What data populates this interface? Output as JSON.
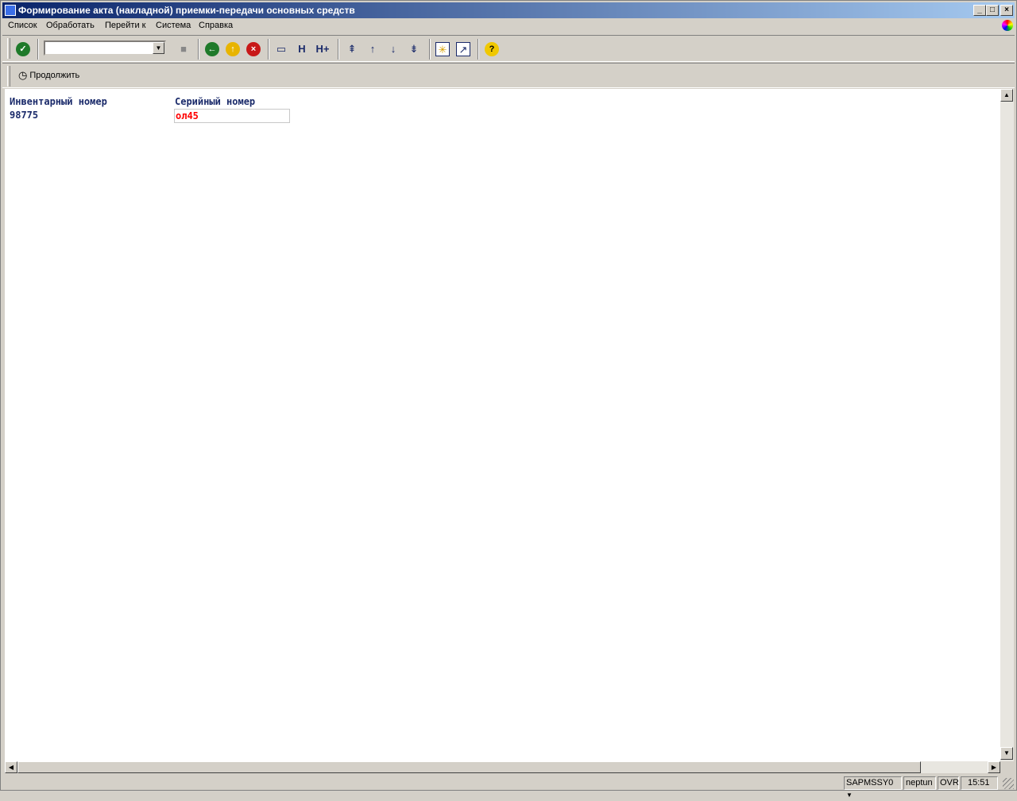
{
  "window": {
    "title": "Формирование акта (накладной) приемки-передачи основных средств",
    "minimize": "_",
    "maximize": "□",
    "close": "×"
  },
  "menu": [
    "Список",
    "Обработать",
    "Перейти к",
    "Система",
    "Справка"
  ],
  "toolbar": {
    "command_field": "",
    "icons": [
      "enter-icon",
      "save-icon",
      "back-icon",
      "exit-icon",
      "cancel-icon",
      "print-icon",
      "find-icon",
      "find-next-icon",
      "first-page-icon",
      "previous-page-icon",
      "next-page-icon",
      "last-page-icon",
      "new-session-icon",
      "shortcut-icon",
      "help-icon"
    ]
  },
  "app_toolbar": {
    "continue_label": "Продолжить"
  },
  "content": {
    "inventory_label": "Инвентарный номер",
    "inventory_value": "98775",
    "serial_label": "Серийный номер",
    "serial_value": "ол45"
  },
  "status": {
    "program": "SAPMSSY0",
    "server": "neptun",
    "mode": "OVR",
    "time": "15:51"
  },
  "colors": {
    "title_start": "#0a246a",
    "label": "#1a2a6a",
    "error_value": "#ff0000"
  }
}
